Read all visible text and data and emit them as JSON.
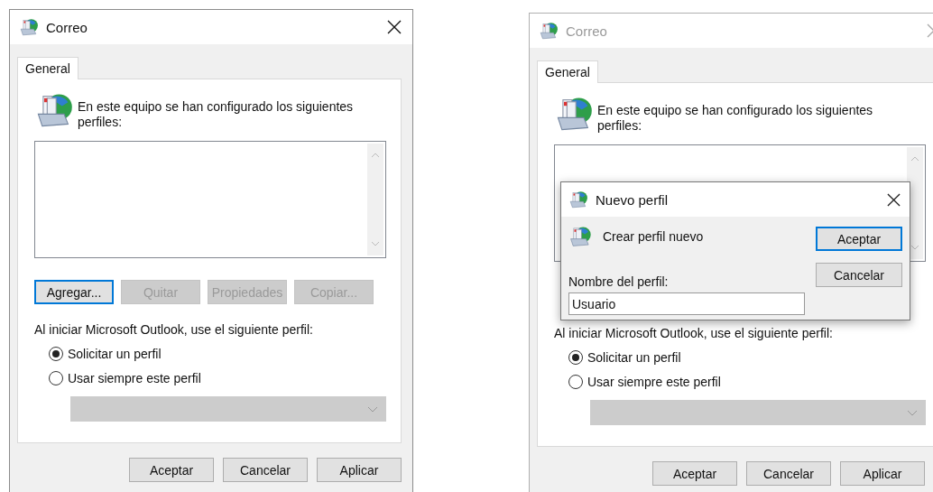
{
  "windows": [
    {
      "title": "Correo",
      "active": true,
      "tabs": [
        {
          "label": "General",
          "selected": true
        }
      ],
      "intro": "En este equipo se han configurado los siguientes perfiles:",
      "profile_buttons": [
        {
          "label": "Agregar...",
          "focused": true,
          "disabled": false
        },
        {
          "label": "Quitar",
          "focused": false,
          "disabled": true
        },
        {
          "label": "Propiedades",
          "focused": false,
          "disabled": true
        },
        {
          "label": "Copiar...",
          "focused": false,
          "disabled": true
        }
      ],
      "startup_label": "Al iniciar Microsoft Outlook, use el siguiente perfil:",
      "startup_options": [
        {
          "label": "Solicitar un perfil",
          "selected": true
        },
        {
          "label": "Usar siempre este perfil",
          "selected": false
        }
      ],
      "profile_select": {
        "disabled": true
      },
      "buttons": [
        {
          "label": "Aceptar"
        },
        {
          "label": "Cancelar"
        },
        {
          "label": "Aplicar"
        }
      ]
    },
    {
      "title": "Correo",
      "active": false,
      "tabs": [
        {
          "label": "General",
          "selected": true
        }
      ],
      "intro": "En este equipo se han configurado los siguientes perfiles:",
      "startup_label": "Al iniciar Microsoft Outlook, use el siguiente perfil:",
      "startup_options": [
        {
          "label": "Solicitar un perfil",
          "selected": true
        },
        {
          "label": "Usar siempre este perfil",
          "selected": false
        }
      ],
      "profile_select": {
        "disabled": true
      },
      "buttons": [
        {
          "label": "Aceptar"
        },
        {
          "label": "Cancelar"
        },
        {
          "label": "Aplicar"
        }
      ],
      "dialog": {
        "title": "Nuevo perfil",
        "heading": "Crear perfil nuevo",
        "field_label": "Nombre del perfil:",
        "field_value": "Usuario",
        "buttons": [
          {
            "label": "Aceptar",
            "focused": true
          },
          {
            "label": "Cancelar",
            "focused": false
          }
        ]
      }
    }
  ]
}
